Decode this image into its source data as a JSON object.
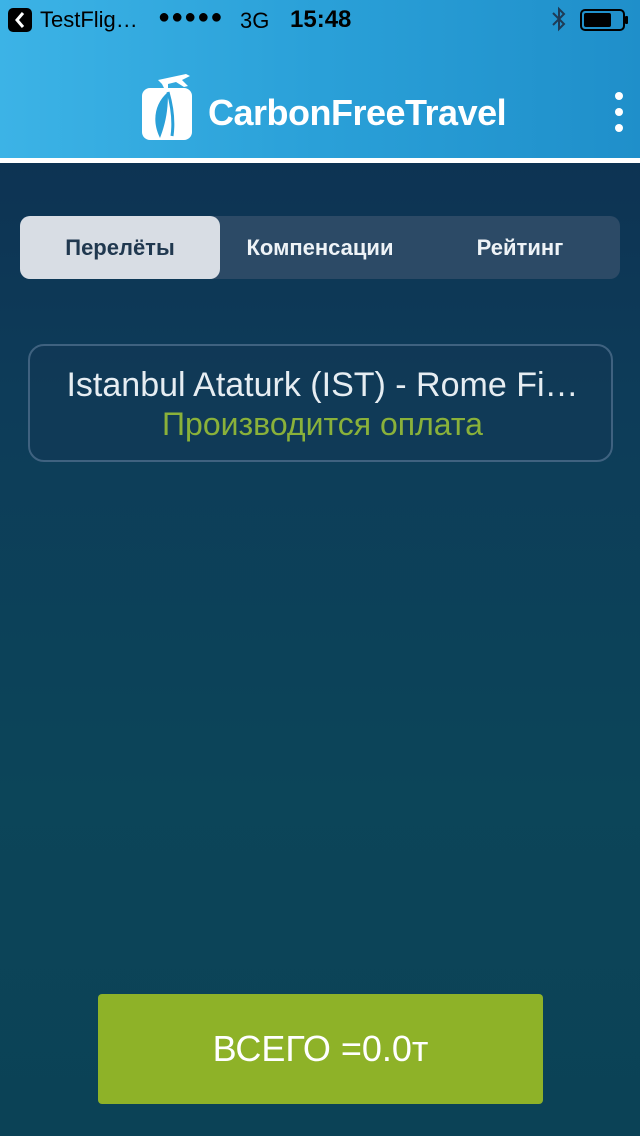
{
  "status_bar": {
    "back_app": "TestFlig…",
    "signal": "●●●●●",
    "network": "3G",
    "time": "15:48"
  },
  "header": {
    "brand": "CarbonFreeTravel",
    "brand_color": "#2aa0d8"
  },
  "tabs": [
    {
      "label": "Перелёты",
      "active": true
    },
    {
      "label": "Компенсации",
      "active": false
    },
    {
      "label": "Рейтинг",
      "active": false
    }
  ],
  "flights": [
    {
      "route": "Istanbul Ataturk (IST) - Rome Fi…",
      "status": "Производится оплата",
      "status_color": "#8ab13a"
    }
  ],
  "total_button": {
    "label": "ВСЕГО =0.0т",
    "color": "#8eb228"
  },
  "icons": [
    "back-icon",
    "bluetooth-icon",
    "battery-icon",
    "logo-icon",
    "more-menu-icon"
  ]
}
